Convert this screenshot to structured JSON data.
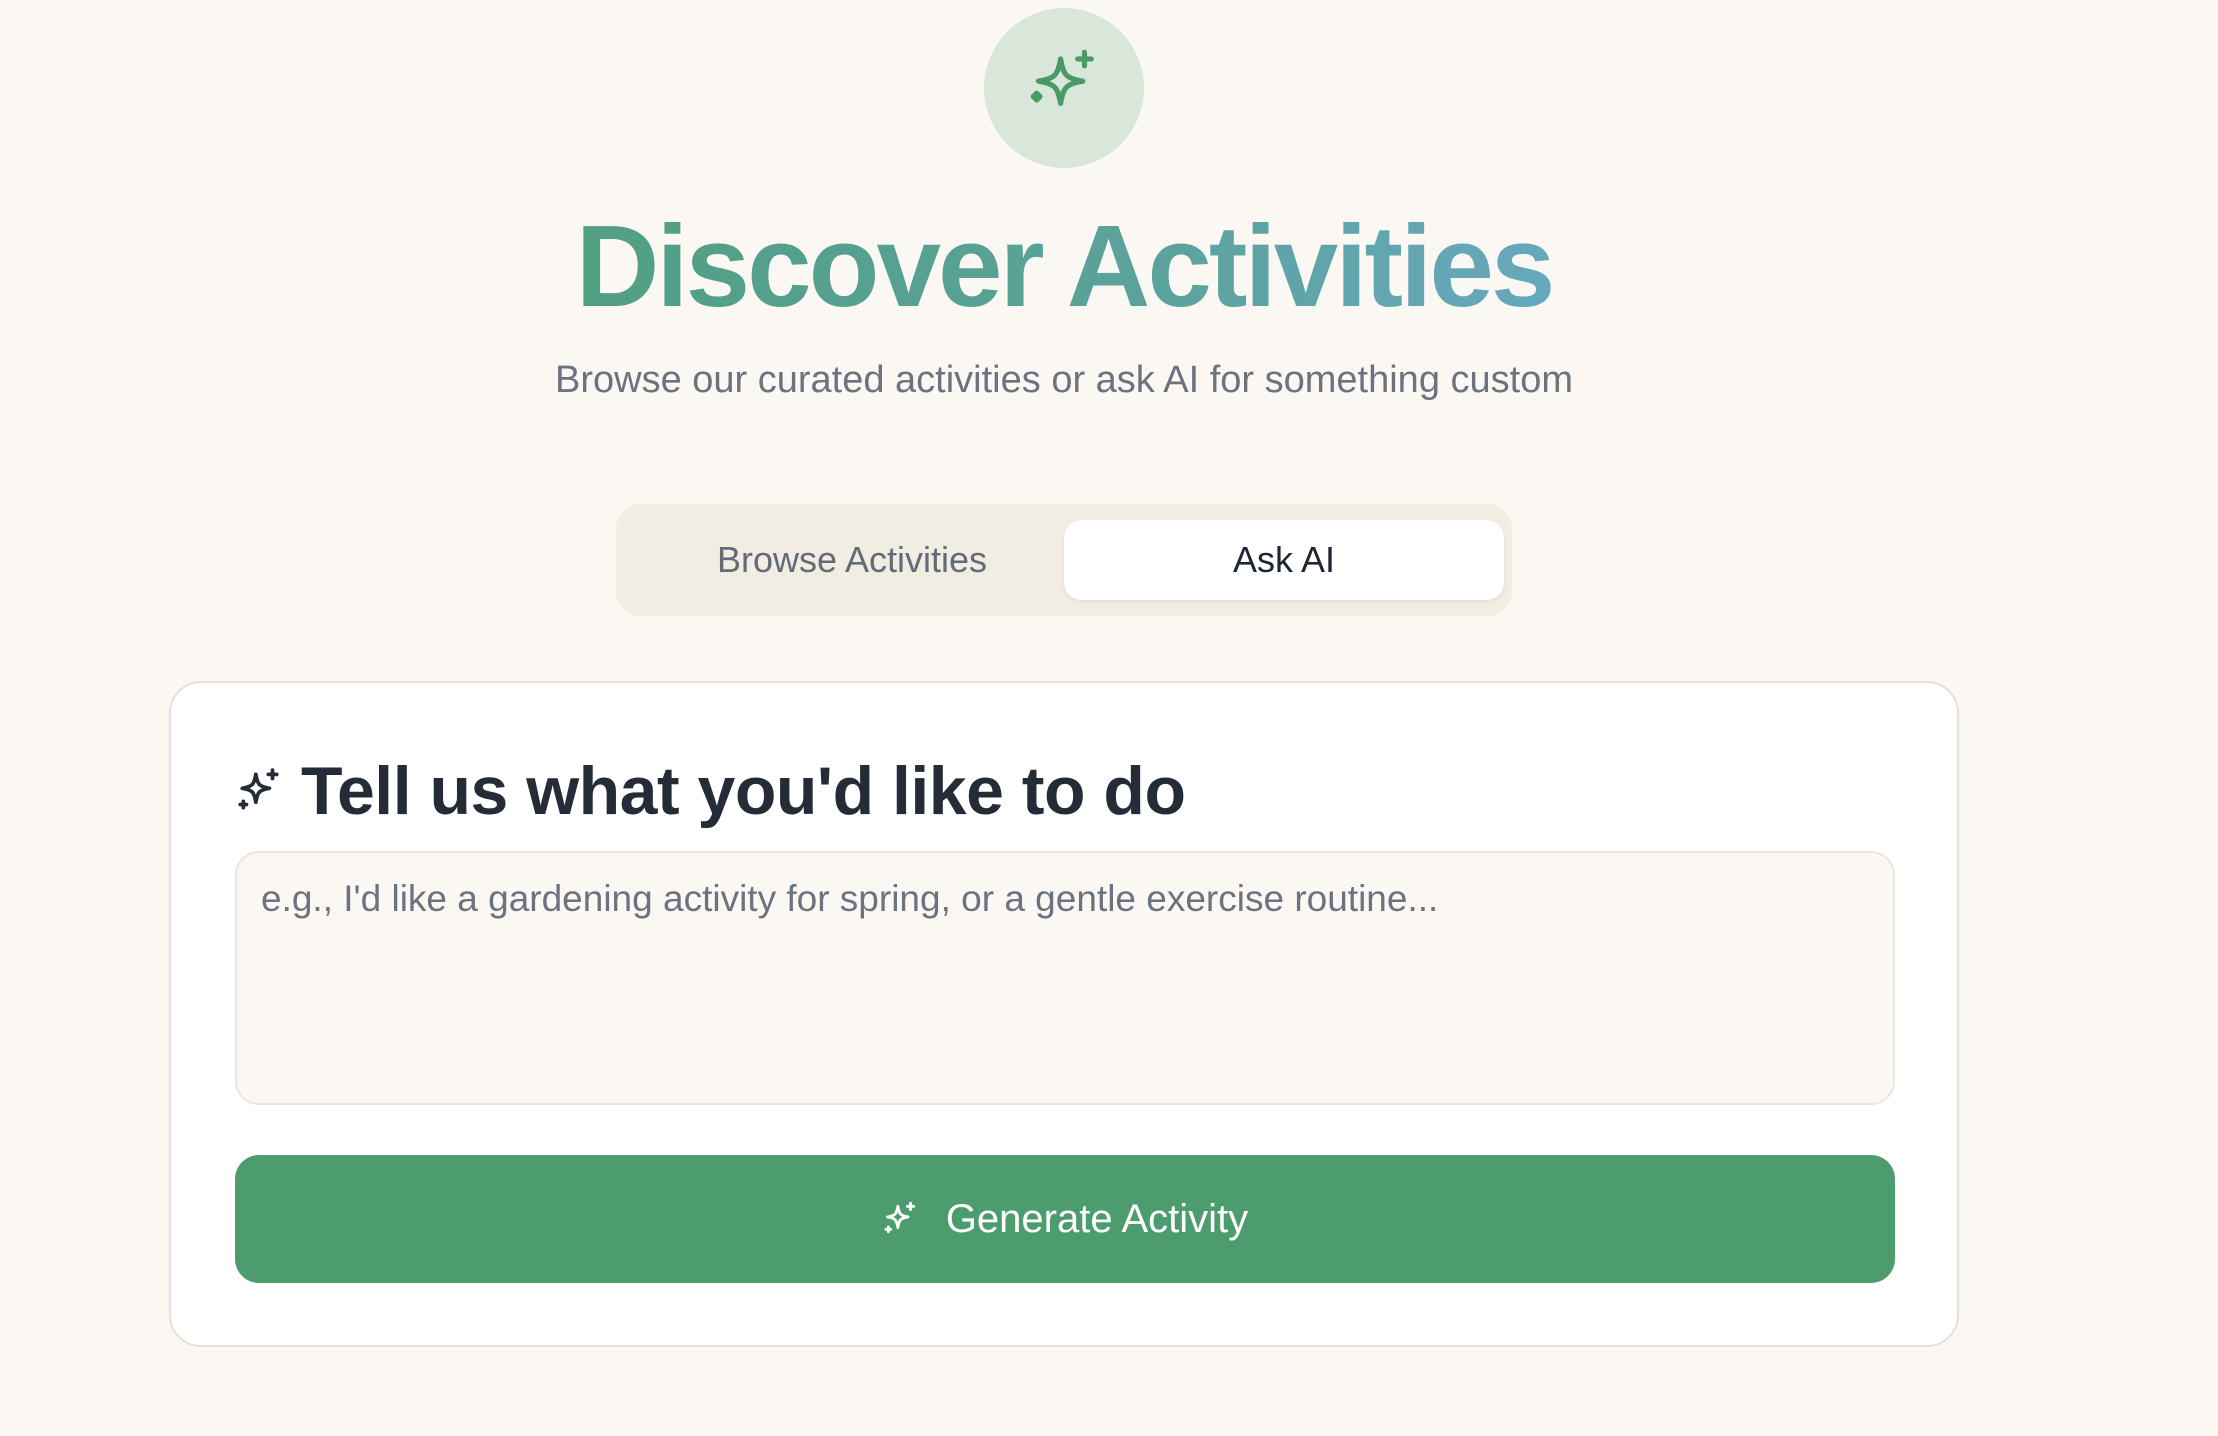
{
  "header": {
    "icon": "sparkles-icon",
    "title": "Discover Activities",
    "subtitle": "Browse our curated activities or ask AI for something custom"
  },
  "tabs": [
    {
      "label": "Browse Activities",
      "active": false
    },
    {
      "label": "Ask AI",
      "active": true
    }
  ],
  "ai_card": {
    "heading_icon": "sparkles-icon",
    "heading": "Tell us what you'd like to do",
    "prompt": {
      "value": "",
      "placeholder": "e.g., I'd like a gardening activity for spring, or a gentle exercise routine..."
    },
    "generate_button": {
      "icon": "sparkles-icon",
      "label": "Generate Activity"
    }
  },
  "colors": {
    "background": "#fbf8f3",
    "accent_green": "#4d9c6d",
    "badge_bg": "#d9e7da",
    "title_gradient_start": "#519f84",
    "title_gradient_end": "#67a8bd",
    "tab_track": "#f1ede3"
  }
}
